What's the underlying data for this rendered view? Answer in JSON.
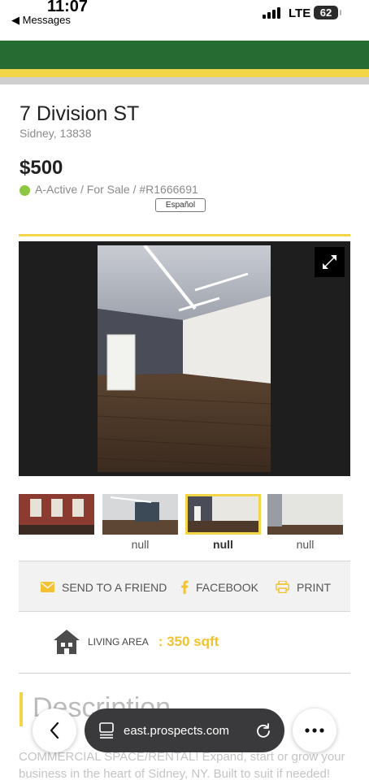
{
  "status_bar": {
    "time": "11:07",
    "back_app": "◀ Messages",
    "network": "LTE",
    "battery": "62"
  },
  "listing": {
    "address": "7 Division ST",
    "location": "Sidney, 13838",
    "price": "$500",
    "status": "A-Active / For Sale / #R1666691",
    "language_button": "Español"
  },
  "gallery": {
    "thumb_captions": [
      "",
      "null",
      "null",
      "null"
    ],
    "selected_thumb": 2
  },
  "share": {
    "send": "SEND TO A FRIEND",
    "facebook": "FACEBOOK",
    "print": "PRINT"
  },
  "details": {
    "living_area_label": "LIVING AREA",
    "living_area_value": ": 350 sqft"
  },
  "description": {
    "heading": "Description",
    "text": "COMMERCIAL SPACE/RENTAL! Expand, start or grow your business in the heart of Sidney, NY. Built to suit if needed!"
  },
  "browser": {
    "url": "east.prospects.com"
  },
  "colors": {
    "brand_green": "#256b32",
    "accent_yellow": "#f3d54a",
    "status_green": "#8dc63f",
    "value_yellow": "#f2c230"
  },
  "icons": [
    "expand-icon",
    "envelope-icon",
    "facebook-icon",
    "printer-icon",
    "house-icon",
    "back-chevron-icon",
    "tabs-icon",
    "reload-icon",
    "more-icon"
  ]
}
